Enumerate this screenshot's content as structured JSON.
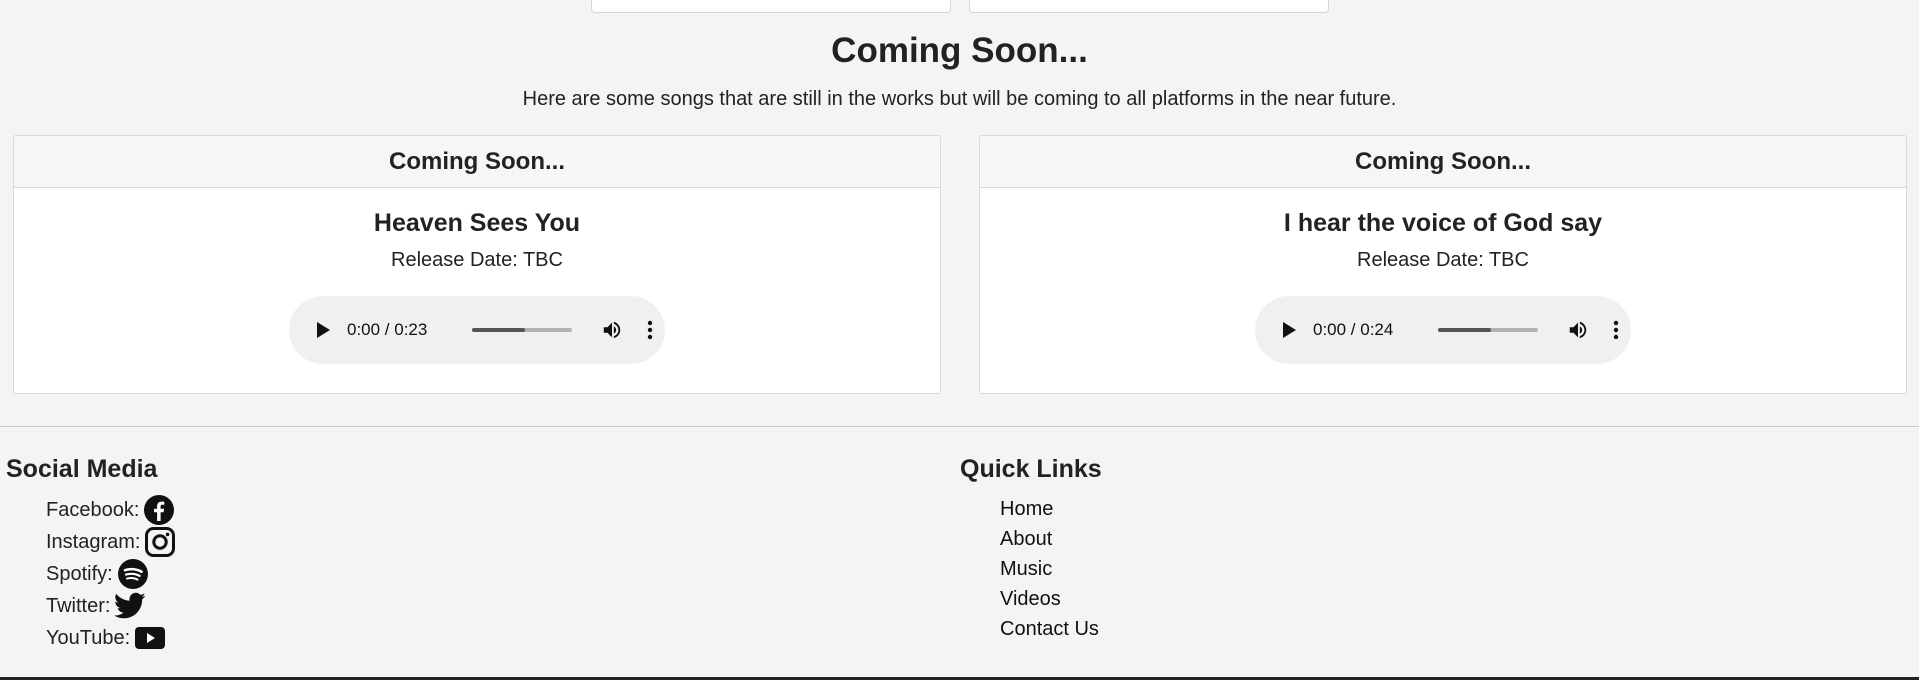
{
  "coming_soon": {
    "title": "Coming Soon...",
    "description": "Here are some songs that are still in the works but will be coming to all platforms in the near future."
  },
  "cards": [
    {
      "header": "Coming Soon...",
      "song_title": "Heaven Sees You",
      "release": "Release Date: TBC",
      "player": {
        "time": "0:00 / 0:23",
        "seek_fraction": 0.53,
        "play_icon": "play-icon",
        "volume_icon": "volume-icon",
        "more_icon": "more-vert-icon"
      }
    },
    {
      "header": "Coming Soon...",
      "song_title": "I hear the voice of God say",
      "release": "Release Date: TBC",
      "player": {
        "time": "0:00 / 0:24",
        "seek_fraction": 0.53,
        "play_icon": "play-icon",
        "volume_icon": "volume-icon",
        "more_icon": "more-vert-icon"
      }
    }
  ],
  "footer": {
    "social_heading": "Social Media",
    "social": [
      {
        "label": "Facebook:",
        "icon": "facebook-icon"
      },
      {
        "label": "Instagram:",
        "icon": "instagram-icon"
      },
      {
        "label": "Spotify:",
        "icon": "spotify-icon"
      },
      {
        "label": "Twitter:",
        "icon": "twitter-icon"
      },
      {
        "label": "YouTube:",
        "icon": "youtube-icon"
      }
    ],
    "links_heading": "Quick Links",
    "links": [
      "Home",
      "About",
      "Music",
      "Videos",
      "Contact Us"
    ]
  },
  "colors": {
    "page_bg": "#f4f4f4",
    "card_bg": "#ffffff",
    "player_bg": "#eff0f2",
    "text": "#222222"
  }
}
